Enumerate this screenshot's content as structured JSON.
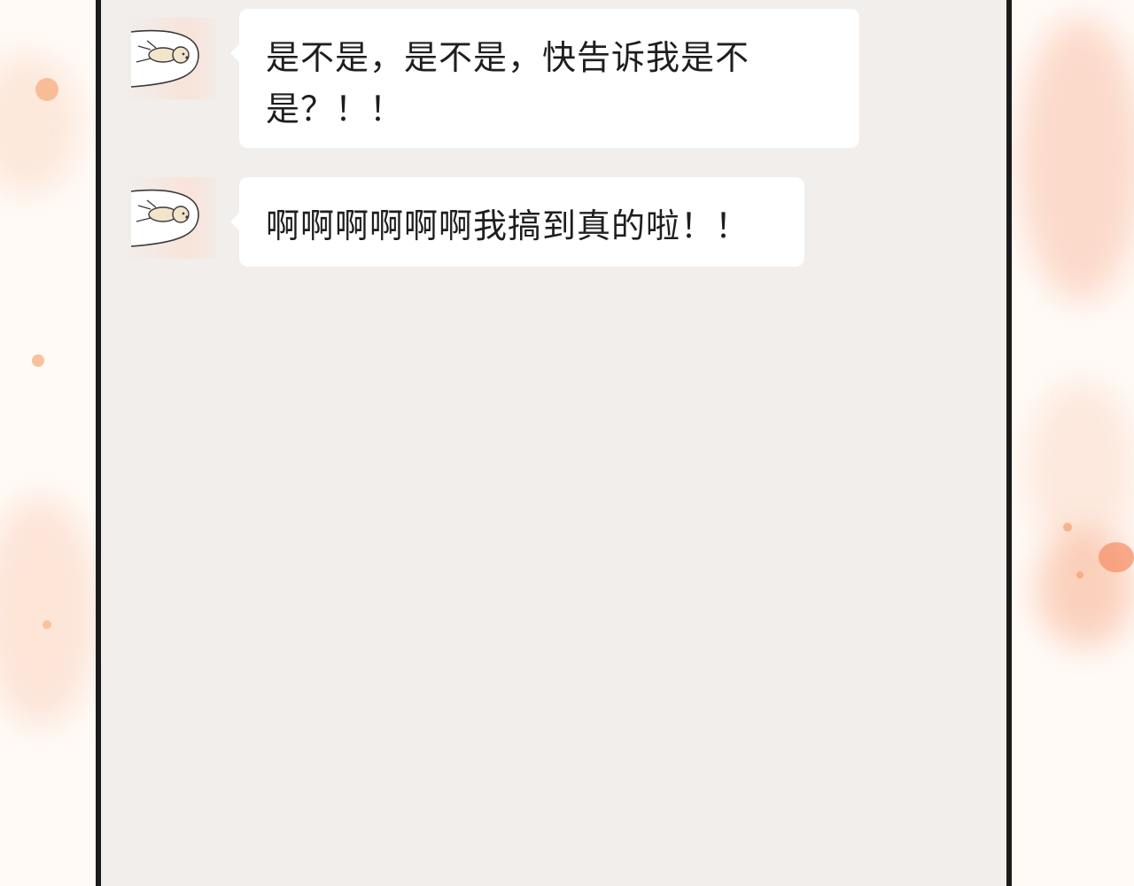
{
  "chat": {
    "messages": [
      {
        "sender": "dog-avatar",
        "text": "是不是，是不是，快告诉我是不\n是？！！"
      },
      {
        "sender": "dog-avatar",
        "text": "啊啊啊啊啊啊我搞到真的啦！！"
      }
    ]
  },
  "colors": {
    "chat_background": "#f1eeeb",
    "bubble_background": "#ffffff",
    "frame_border": "#1b1b1b",
    "splash_peach": "#f7b08f",
    "avatar_highlight": "#fbded2"
  },
  "icons": {
    "avatar": "flying-dog-icon"
  }
}
